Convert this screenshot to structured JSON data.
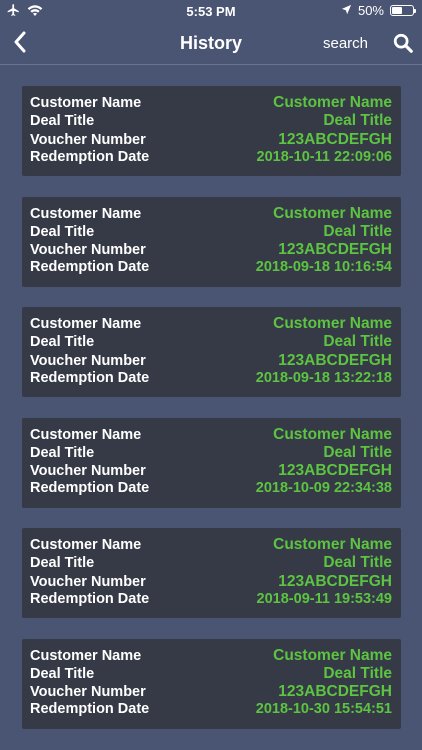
{
  "status_bar": {
    "time": "5:53 PM",
    "battery": "50%",
    "battery_level": 0.5,
    "icons": [
      "airplane-icon",
      "wifi-icon",
      "location-arrow-icon",
      "battery-icon"
    ]
  },
  "nav": {
    "title": "History",
    "search_label": "search",
    "back_icon": "chevron-left-icon",
    "search_icon": "magnifier-icon"
  },
  "colors": {
    "background": "#4a5573",
    "card": "#353a46",
    "value_green": "#5cc441",
    "label_white": "#ffffff"
  },
  "labels": {
    "customer_name": "Customer Name",
    "deal_title": "Deal Title",
    "voucher_number": "Voucher Number",
    "redemption_date": "Redemption Date"
  },
  "history": [
    {
      "customer_name": "Customer Name",
      "deal_title": "Deal Title",
      "voucher_number": "123ABCDEFGH",
      "redemption_date": "2018-10-11 22:09:06"
    },
    {
      "customer_name": "Customer Name",
      "deal_title": "Deal Title",
      "voucher_number": "123ABCDEFGH",
      "redemption_date": "2018-09-18 10:16:54"
    },
    {
      "customer_name": "Customer Name",
      "deal_title": "Deal Title",
      "voucher_number": "123ABCDEFGH",
      "redemption_date": "2018-09-18 13:22:18"
    },
    {
      "customer_name": "Customer Name",
      "deal_title": "Deal Title",
      "voucher_number": "123ABCDEFGH",
      "redemption_date": "2018-10-09 22:34:38"
    },
    {
      "customer_name": "Customer Name",
      "deal_title": "Deal Title",
      "voucher_number": "123ABCDEFGH",
      "redemption_date": "2018-09-11 19:53:49"
    },
    {
      "customer_name": "Customer Name",
      "deal_title": "Deal Title",
      "voucher_number": "123ABCDEFGH",
      "redemption_date": "2018-10-30 15:54:51"
    }
  ]
}
